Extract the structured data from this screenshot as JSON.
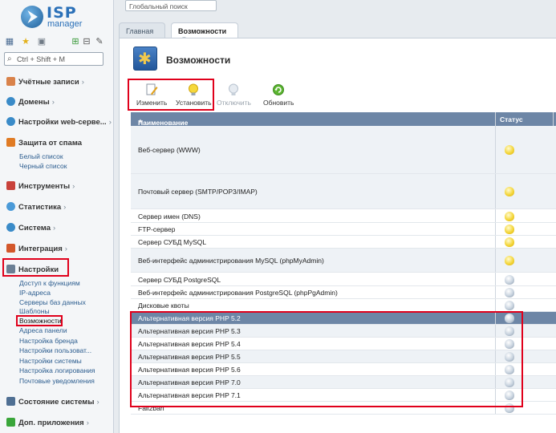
{
  "logo": {
    "name": "ISP",
    "sub": "manager"
  },
  "sidebar": {
    "search_placeholder": "Ctrl + Shift + M",
    "sections": [
      {
        "label": "Учётные записи",
        "items": []
      },
      {
        "label": "Домены",
        "items": []
      },
      {
        "label": "Настройки web-серве...",
        "items": []
      },
      {
        "label": "Защита от спама",
        "items": [
          "Белый список",
          "Черный список"
        ]
      },
      {
        "label": "Инструменты",
        "items": []
      },
      {
        "label": "Статистика",
        "items": []
      },
      {
        "label": "Система",
        "items": []
      },
      {
        "label": "Интеграция",
        "items": []
      },
      {
        "label": "Настройки",
        "items": [
          "Доступ к функциям",
          "IP-адреса",
          "Серверы баз данных",
          "Шаблоны",
          "Возможности",
          "Адреса панели",
          "Настройка бренда",
          "Настройки пользоват...",
          "Настройки системы",
          "Настройка логирования",
          "Почтовые уведомления"
        ]
      },
      {
        "label": "Состояние системы",
        "items": []
      },
      {
        "label": "Доп. приложения",
        "items": []
      }
    ]
  },
  "top": {
    "global_search": "Глобальный поиск"
  },
  "tabs": [
    "Главная",
    "Возможности"
  ],
  "page": {
    "title": "Возможности"
  },
  "toolbar": {
    "edit": "Изменить",
    "install": "Установить",
    "disable": "Отключить",
    "refresh": "Обновить"
  },
  "grid": {
    "col_name": "Наименование",
    "sort_arrow": "▲",
    "col_status": "Статус",
    "rows": [
      {
        "name": "Веб-сервер (WWW)",
        "on": true
      },
      {
        "name": "Почтовый сервер (SMTP/POP3/IMAP)",
        "on": true
      },
      {
        "name": "Сервер имен (DNS)",
        "on": true
      },
      {
        "name": "FTP-сервер",
        "on": true
      },
      {
        "name": "Сервер СУБД MySQL",
        "on": true
      },
      {
        "name": "Веб-интерфейс администрирования MySQL (phpMyAdmin)",
        "on": true
      },
      {
        "name": "Сервер СУБД PostgreSQL",
        "on": false
      },
      {
        "name": "Веб-интерфейс администрирования PostgreSQL (phpPgAdmin)",
        "on": false
      },
      {
        "name": "Дисковые квоты",
        "on": false
      },
      {
        "name": "Альтернативная версия PHP 5.2",
        "on": false
      },
      {
        "name": "Альтернативная версия PHP 5.3",
        "on": false
      },
      {
        "name": "Альтернативная версия PHP 5.4",
        "on": false
      },
      {
        "name": "Альтернативная версия PHP 5.5",
        "on": false
      },
      {
        "name": "Альтернативная версия PHP 5.6",
        "on": false
      },
      {
        "name": "Альтернативная версия PHP 7.0",
        "on": false
      },
      {
        "name": "Альтернативная версия PHP 7.1",
        "on": false
      },
      {
        "name": "Fail2ban",
        "on": false
      }
    ]
  }
}
